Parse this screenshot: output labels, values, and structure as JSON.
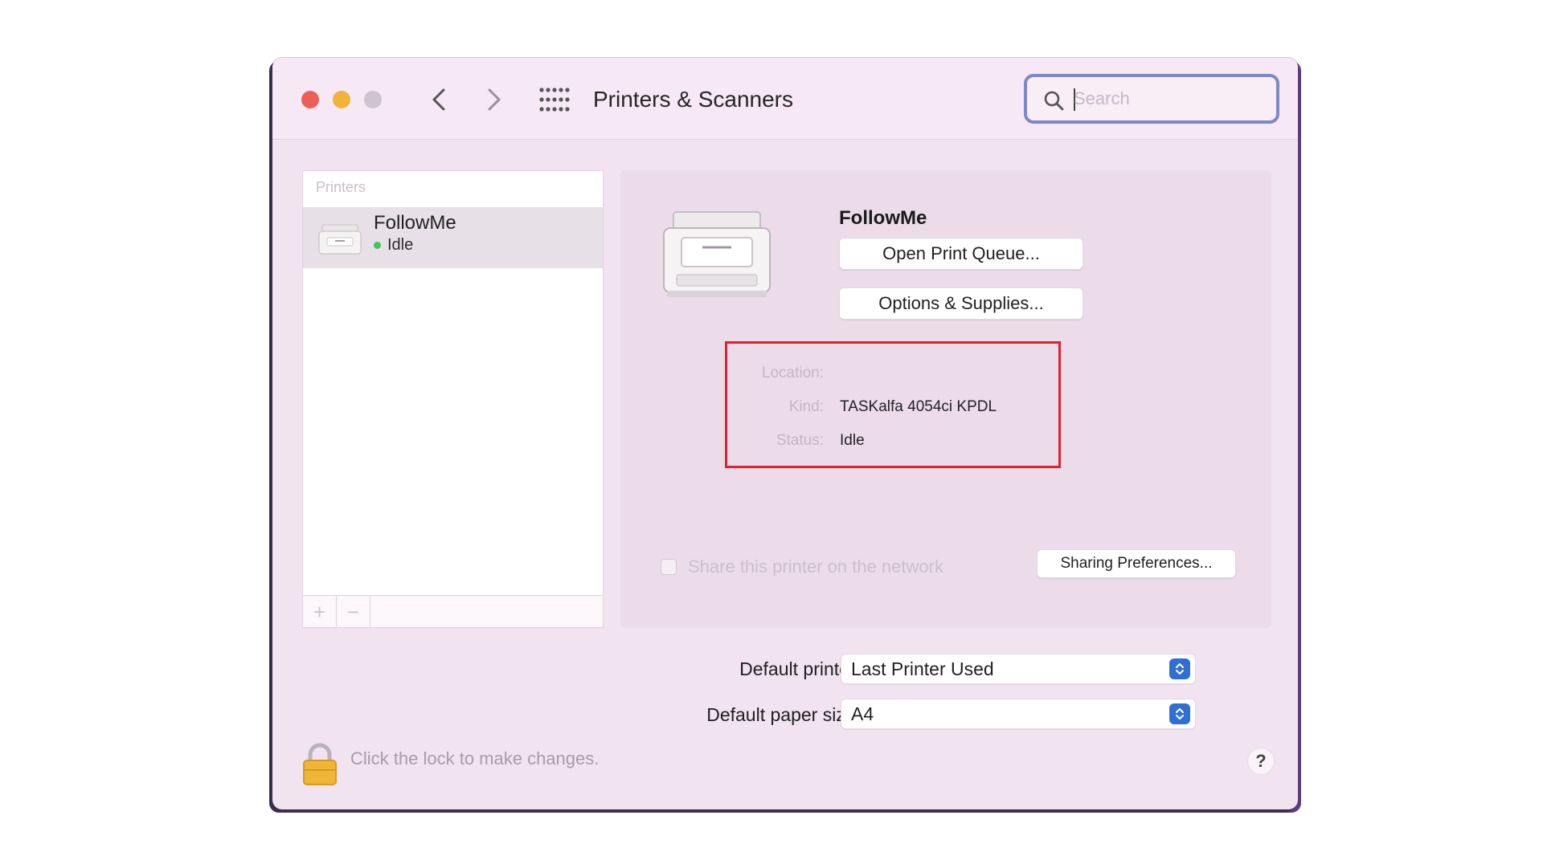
{
  "window": {
    "title": "Printers & Scanners"
  },
  "search": {
    "placeholder": "Search",
    "value": ""
  },
  "sidebar": {
    "header": "Printers",
    "printers": [
      {
        "name": "FollowMe",
        "status": "Idle",
        "status_color": "#46c35a"
      }
    ],
    "add_label": "+",
    "remove_label": "−"
  },
  "detail": {
    "printer_name": "FollowMe",
    "open_queue_label": "Open Print Queue...",
    "options_label": "Options & Supplies...",
    "info": {
      "location_label": "Location:",
      "location_value": "",
      "kind_label": "Kind:",
      "kind_value": "TASKalfa 4054ci KPDL",
      "status_label": "Status:",
      "status_value": "Idle"
    },
    "share_label": "Share this printer on the network",
    "share_checked": false,
    "sharing_prefs_label": "Sharing Preferences..."
  },
  "defaults": {
    "printer_label": "Default printer:",
    "printer_value": "Last Printer Used",
    "paper_label": "Default paper size:",
    "paper_value": "A4"
  },
  "footer": {
    "lock_text": "Click the lock to make changes.",
    "help_label": "?"
  },
  "icons": {
    "close": "traffic-close",
    "minimize": "traffic-minimize",
    "zoom": "traffic-zoom",
    "back": "chevron-left-icon",
    "forward": "chevron-right-icon",
    "grid": "grid-icon",
    "search": "search-icon",
    "lock": "lock-icon",
    "printer": "printer-icon"
  },
  "colors": {
    "highlight_box": "#e0222c",
    "select_accent": "#2f6fd1",
    "window_bg": "#f1e3f0"
  }
}
